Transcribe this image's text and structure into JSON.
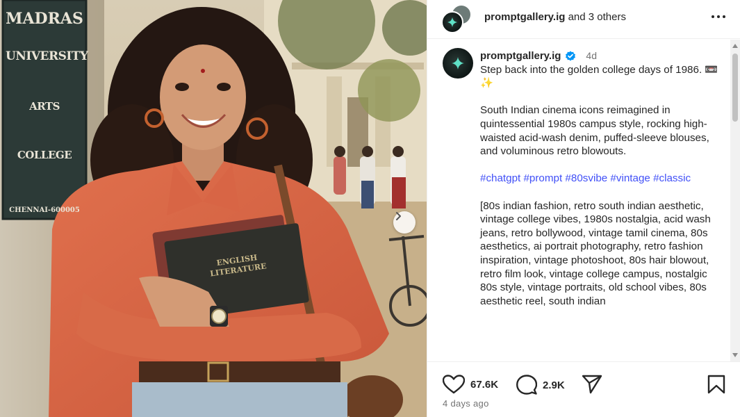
{
  "header": {
    "username": "promptgallery.ig",
    "others_text": "and 3 others"
  },
  "photo": {
    "wall_sign": [
      "MADRAS",
      "UNIVERSITY",
      "ARTS COLLEGE"
    ],
    "sign_city": "CHENNAI-600005",
    "book_title": [
      "ENGLISH",
      "LITERATURE"
    ]
  },
  "caption": {
    "username": "promptgallery.ig",
    "time": "4d",
    "intro": "Step back into the golden college days of 1986. 📼 ✨",
    "body": "South Indian cinema icons reimagined in quintessential 1980s campus style, rocking high-waisted acid-wash denim, puffed-sleeve blouses, and voluminous retro blowouts.",
    "hashtags": "#chatgpt #prompt #80svibe #vintage #classic",
    "keywords": "[80s indian fashion, retro south indian aesthetic, vintage college vibes, 1980s nostalgia, acid wash jeans, retro bollywood, vintage tamil cinema, 80s aesthetics, ai portrait photography, retro fashion inspiration, vintage photoshoot, 80s hair blowout, retro film look, vintage college campus, nostalgic 80s style, vintage portraits, old school vibes, 80s aesthetic reel, south indian"
  },
  "actions": {
    "likes": "67.6K",
    "comments": "2.9K",
    "posted_ago": "4 days ago"
  },
  "icons": {
    "like": "heart-icon",
    "comment": "comment-bubble-icon",
    "share": "paper-plane-icon",
    "save": "bookmark-icon",
    "more": "more-options-icon",
    "verified": "verified-badge-icon",
    "next": "chevron-right-icon"
  },
  "colors": {
    "hashtag": "#4150f7",
    "verified": "#0095f6",
    "muted": "#737373"
  }
}
